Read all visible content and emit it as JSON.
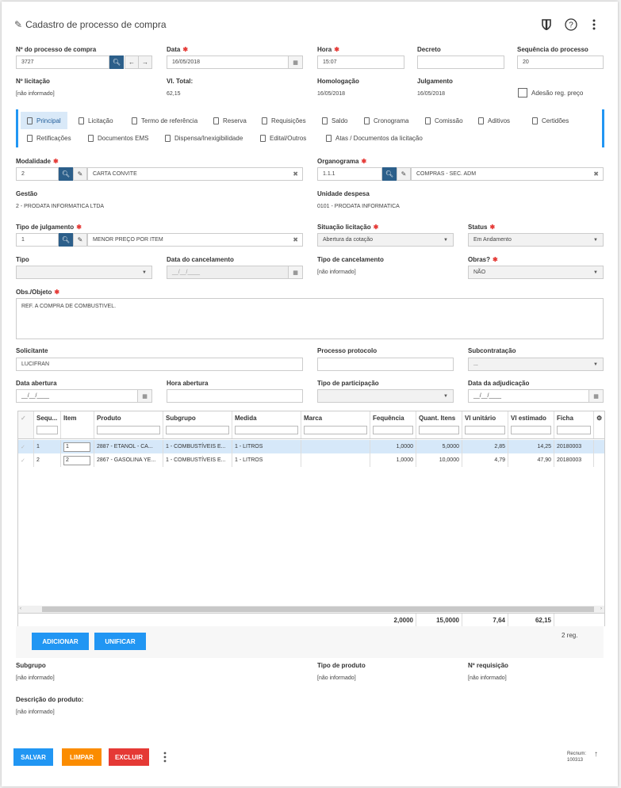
{
  "header": {
    "title": "Cadastro de processo de compra"
  },
  "fields": {
    "num_processo": {
      "label": "Nº do processo de compra",
      "value": "3727"
    },
    "data": {
      "label": "Data",
      "value": "16/05/2018"
    },
    "hora": {
      "label": "Hora",
      "value": "15:07"
    },
    "decreto": {
      "label": "Decreto",
      "value": ""
    },
    "sequencia": {
      "label": "Sequência do processo",
      "value": "20"
    },
    "num_licitacao": {
      "label": "Nº licitação",
      "value": "[não informado]"
    },
    "vl_total": {
      "label": "Vl. Total:",
      "value": "62,15"
    },
    "homologacao": {
      "label": "Homologação",
      "value": "16/05/2018"
    },
    "julgamento": {
      "label": "Julgamento",
      "value": "16/05/2018"
    },
    "adesao": {
      "label": "Adesão reg. preço",
      "checked": false
    }
  },
  "tabs_row1": [
    "Principal",
    "Licitação",
    "Termo de referência",
    "Reserva",
    "Requisições",
    "Saldo",
    "Cronograma",
    "Comissão",
    "Aditivos",
    "Certidões"
  ],
  "tabs_row2": [
    "Retificações",
    "Documentos EMS",
    "Dispensa/Inexigibilidade",
    "Edital/Outros",
    "Atas / Documentos da licitação"
  ],
  "principal": {
    "modalidade": {
      "label": "Modalidade",
      "code": "2",
      "desc": "CARTA CONVITE"
    },
    "organograma": {
      "label": "Organograma",
      "code": "1.1.1",
      "desc": "COMPRAS - SEC. ADM"
    },
    "gestao": {
      "label": "Gestão",
      "value": "2 - PRODATA INFORMATICA LTDA"
    },
    "unidade_despesa": {
      "label": "Unidade despesa",
      "value": "0101 - PRODATA INFORMATICA"
    },
    "tipo_julgamento": {
      "label": "Tipo de julgamento",
      "code": "1",
      "desc": "MENOR PREÇO POR ITEM"
    },
    "situacao_licitacao": {
      "label": "Situação licitação",
      "value": "Abertura da cotação"
    },
    "status": {
      "label": "Status",
      "value": "Em Andamento"
    },
    "tipo": {
      "label": "Tipo",
      "value": ""
    },
    "data_cancelamento": {
      "label": "Data do cancelamento",
      "placeholder": "__/__/____"
    },
    "tipo_cancelamento": {
      "label": "Tipo de cancelamento",
      "value": "[não informado]"
    },
    "obras": {
      "label": "Obras?",
      "value": "NÃO"
    },
    "obs_objeto": {
      "label": "Obs./Objeto",
      "value": "REF. A COMPRA DE COMBUSTIVEL."
    },
    "solicitante": {
      "label": "Solicitante",
      "value": "LUCIFRAN"
    },
    "processo_protocolo": {
      "label": "Processo protocolo",
      "value": ""
    },
    "subcontratacao": {
      "label": "Subcontratação",
      "value": "..."
    },
    "data_abertura": {
      "label": "Data abertura",
      "placeholder": "__/__/____"
    },
    "hora_abertura": {
      "label": "Hora abertura",
      "value": ""
    },
    "tipo_participacao": {
      "label": "Tipo de participação",
      "value": ""
    },
    "data_adjudicacao": {
      "label": "Data da adjudicação",
      "placeholder": "__/__/____"
    }
  },
  "grid": {
    "columns": [
      "Sequ...",
      "Item",
      "Produto",
      "Subgrupo",
      "Medida",
      "Marca",
      "Fequência",
      "Quant. Itens",
      "Vl unitário",
      "Vl estimado",
      "Ficha"
    ],
    "rows": [
      {
        "seq": "1",
        "item": "1",
        "produto": "2887 - ETANOL - CA...",
        "subgrupo": "1 - COMBUSTÍVEIS E...",
        "medida": "1 - LITROS",
        "marca": "",
        "frequencia": "1,0000",
        "quant": "5,0000",
        "vl_unit": "2,85",
        "vl_est": "14,25",
        "ficha": "20180003"
      },
      {
        "seq": "2",
        "item": "2",
        "produto": "2867 - GASOLINA YE...",
        "subgrupo": "1 - COMBUSTÍVEIS E...",
        "medida": "1 - LITROS",
        "marca": "",
        "frequencia": "1,0000",
        "quant": "10,0000",
        "vl_unit": "4,79",
        "vl_est": "47,90",
        "ficha": "20180003"
      }
    ],
    "totals": {
      "frequencia": "2,0000",
      "quant": "15,0000",
      "vl_unit": "7,64",
      "vl_est": "62,15"
    },
    "count": "2 reg."
  },
  "grid_buttons": {
    "add": "ADICIONAR",
    "unify": "UNIFICAR"
  },
  "detail": {
    "subgrupo": {
      "label": "Subgrupo",
      "value": "[não informado]"
    },
    "tipo_produto": {
      "label": "Tipo de produto",
      "value": "[não informado]"
    },
    "num_requisicao": {
      "label": "Nº requisição",
      "value": "[não informado]"
    },
    "descricao": {
      "label": "Descrição do produto:",
      "value": "[não informado]"
    }
  },
  "footer": {
    "save": "SALVAR",
    "clear": "LIMPAR",
    "delete": "EXCLUIR",
    "recnum_label": "Recnum:",
    "recnum_value": "100313"
  }
}
